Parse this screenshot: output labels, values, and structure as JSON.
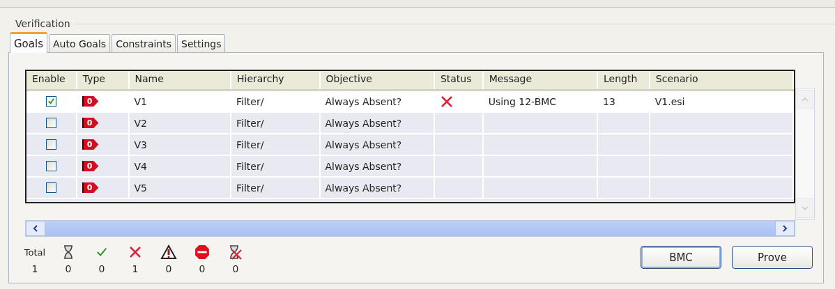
{
  "group": {
    "title": "Verification"
  },
  "tabs": [
    {
      "label": "Goals",
      "selected": true
    },
    {
      "label": "Auto Goals",
      "selected": false
    },
    {
      "label": "Constraints",
      "selected": false
    },
    {
      "label": "Settings",
      "selected": false
    }
  ],
  "table": {
    "columns": [
      "Enable",
      "Type",
      "Name",
      "Hierarchy",
      "Objective",
      "Status",
      "Message",
      "Length",
      "Scenario"
    ],
    "rows": [
      {
        "enabled": true,
        "type_badge": "0",
        "name": "V1",
        "hierarchy": "Filter/",
        "objective": "Always Absent?",
        "kind": "failed",
        "message": "Using 12-BMC",
        "length": "13",
        "scenario": "V1.esi",
        "selected": true
      },
      {
        "enabled": false,
        "type_badge": "0",
        "name": "V2",
        "hierarchy": "Filter/",
        "objective": "Always Absent?",
        "kind": "untested",
        "selected": false
      },
      {
        "enabled": false,
        "type_badge": "0",
        "name": "V3",
        "hierarchy": "Filter/",
        "objective": "Always Absent?",
        "kind": "untested",
        "selected": false
      },
      {
        "enabled": false,
        "type_badge": "0",
        "name": "V4",
        "hierarchy": "Filter/",
        "objective": "Always Absent?",
        "kind": "untested",
        "selected": false
      },
      {
        "enabled": false,
        "type_badge": "0",
        "name": "V5",
        "hierarchy": "Filter/",
        "objective": "Always Absent?",
        "kind": "untested",
        "selected": false
      }
    ]
  },
  "summary": [
    {
      "kind": "total",
      "label": "Total",
      "count": "1"
    },
    {
      "kind": "pending",
      "count": "0"
    },
    {
      "kind": "passed",
      "count": "0"
    },
    {
      "kind": "failed",
      "count": "1"
    },
    {
      "kind": "warning",
      "count": "0"
    },
    {
      "kind": "stop",
      "count": "0"
    },
    {
      "kind": "cancelled",
      "count": "0"
    }
  ],
  "buttons": [
    {
      "label": "BMC",
      "default": true
    },
    {
      "label": "Prove",
      "default": false
    }
  ]
}
